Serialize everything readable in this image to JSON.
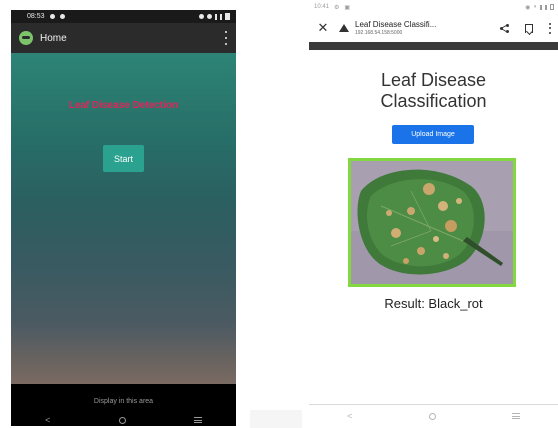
{
  "left_phone": {
    "status_bar": {
      "time": "08:53"
    },
    "appbar": {
      "title": "Home"
    },
    "content": {
      "title": "Leaf Disease Detection",
      "start_label": "Start",
      "display_text": "Display in this area"
    },
    "nav": {
      "back": "<"
    }
  },
  "right_phone": {
    "status_bar": {
      "time": "10:41"
    },
    "browser": {
      "page_title": "Leaf Disease Classifi...",
      "url": "192.168.54.158:5000"
    },
    "page": {
      "heading_line1": "Leaf Disease",
      "heading_line2": "Classification",
      "upload_label": "Upload Image",
      "result_text": "Result: Black_rot"
    },
    "nav": {
      "back": "<"
    }
  },
  "colors": {
    "title_red": "#e5245a",
    "start_teal": "#2aa28f",
    "upload_blue": "#1a73e8",
    "image_border_green": "#84d83f"
  }
}
